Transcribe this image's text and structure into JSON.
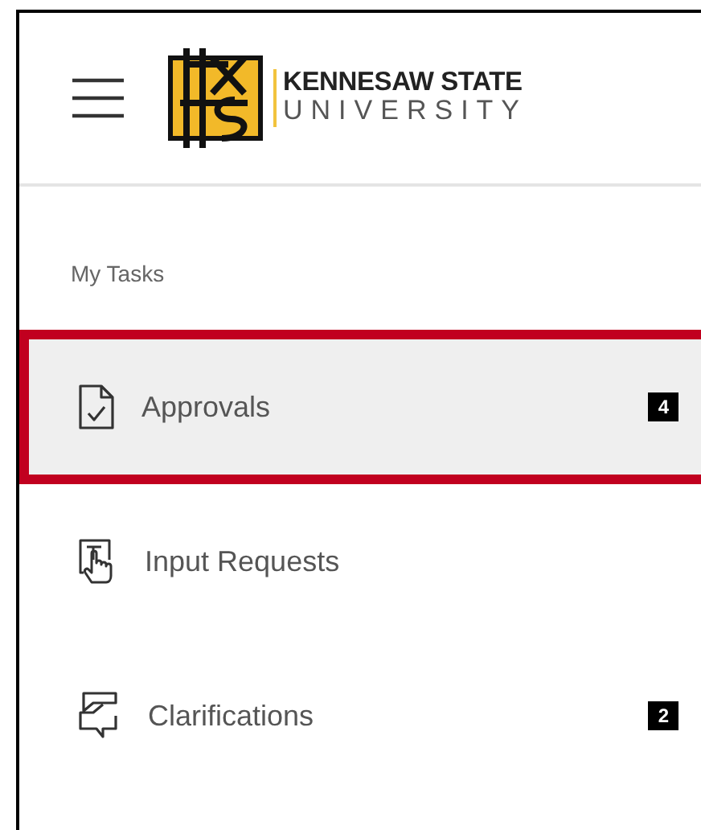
{
  "header": {
    "logo_line_1": "KENNESAW STATE",
    "logo_line_2": "UNIVERSITY"
  },
  "section_title": "My Tasks",
  "items": [
    {
      "kind": "approvals",
      "label": "Approvals",
      "badge": "4",
      "selected": true
    },
    {
      "kind": "input",
      "label": "Input Requests",
      "selected": false
    },
    {
      "kind": "clarifications",
      "label": "Clarifications",
      "badge": "2",
      "selected": false
    }
  ]
}
